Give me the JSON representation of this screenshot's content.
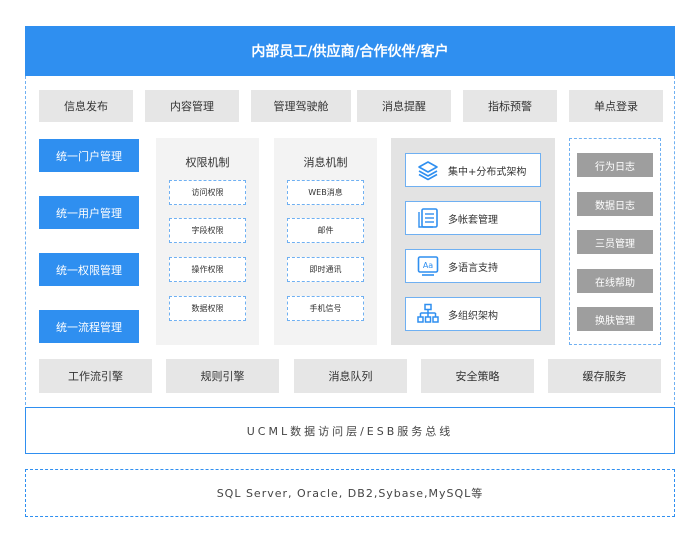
{
  "header": {
    "title": "内部员工/供应商/合作伙伴/客户"
  },
  "top_row": [
    "信息发布",
    "内容管理",
    "管理驾驶舱",
    "消息提醒",
    "指标预警",
    "单点登录"
  ],
  "left_column": [
    "统一门户管理",
    "统一用户管理",
    "统一权限管理",
    "统一流程管理"
  ],
  "permission_panel": {
    "title": "权限机制",
    "items": [
      "访问权限",
      "字段权限",
      "操作权限",
      "数据权限"
    ]
  },
  "message_panel": {
    "title": "消息机制",
    "items": [
      "WEB消息",
      "邮件",
      "即时通讯",
      "手机信号"
    ]
  },
  "feature_panel": {
    "items": [
      {
        "label": "集中+分布式架构",
        "icon": "layers-icon"
      },
      {
        "label": "多帐套管理",
        "icon": "list-document-icon"
      },
      {
        "label": "多语言支持",
        "icon": "language-icon"
      },
      {
        "label": "多组织架构",
        "icon": "org-chart-icon"
      }
    ]
  },
  "right_column": [
    "行为日志",
    "数据日志",
    "三员管理",
    "在线帮助",
    "换肤管理"
  ],
  "bottom_row": [
    "工作流引擎",
    "规则引擎",
    "消息队列",
    "安全策略",
    "缓存服务"
  ],
  "data_access_layer": "UCML数据访问层/ESB服务总线",
  "database_layer": "SQL Server, Oracle, DB2,Sybase,MySQL等",
  "colors": {
    "primary": "#2f8ff0",
    "tile_gray": "#e6e6e6",
    "dark_gray": "#9e9e9e",
    "panel_gray": "#f3f3f3"
  }
}
